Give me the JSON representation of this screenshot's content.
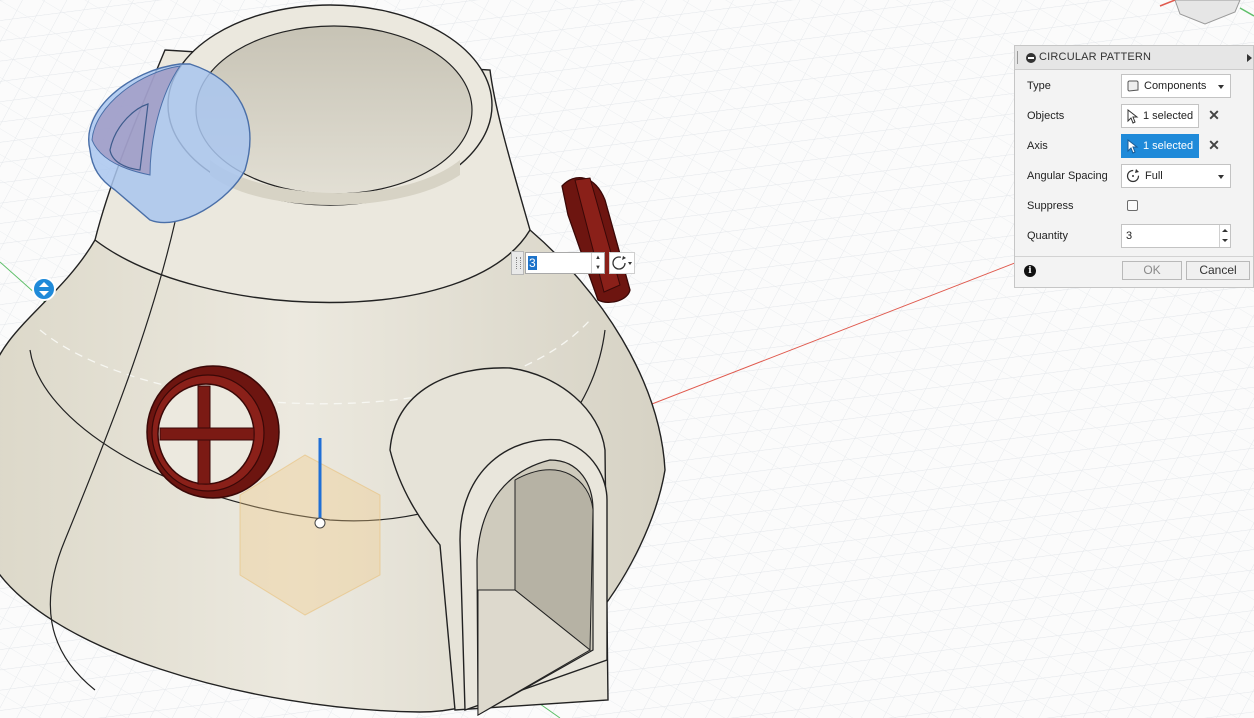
{
  "dialog": {
    "title": "CIRCULAR PATTERN",
    "rows": {
      "type": {
        "label": "Type",
        "value": "Components",
        "icon": "component-icon"
      },
      "objects": {
        "label": "Objects",
        "value": "1 selected",
        "icon": "cursor-arrow-icon"
      },
      "axis": {
        "label": "Axis",
        "value": "1 selected",
        "icon": "cursor-arrow-icon",
        "active": true
      },
      "angular_spacing": {
        "label": "Angular Spacing",
        "value": "Full",
        "icon": "rotate-icon"
      },
      "suppress": {
        "label": "Suppress",
        "checked": false
      },
      "quantity": {
        "label": "Quantity",
        "value": "3"
      }
    },
    "ok_label": "OK",
    "cancel_label": "Cancel"
  },
  "viewport_manipulator": {
    "quantity_value": "3",
    "direction_icon": "rotate-direction-icon"
  },
  "colors": {
    "selection_blue": "#1f8ad9",
    "model_body": "#e7e3d7",
    "window_red": "#7b1a14",
    "ghost_blue": "#a9c6ee",
    "grid_line": "#e2e5e8",
    "axis_red": "#e05a4e",
    "axis_green": "#5fbf6a"
  }
}
